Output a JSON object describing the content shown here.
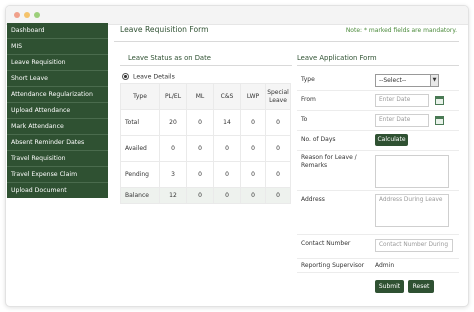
{
  "sidebar": {
    "items": [
      {
        "label": "Dashboard"
      },
      {
        "label": "MIS"
      },
      {
        "label": "Leave Requisition"
      },
      {
        "label": "Short Leave"
      },
      {
        "label": "Attendance Regularization"
      },
      {
        "label": "Upload Attendance"
      },
      {
        "label": "Mark Attendance"
      },
      {
        "label": "Absent Reminder Dates"
      },
      {
        "label": "Travel Requisition"
      },
      {
        "label": "Travel Expense Claim"
      },
      {
        "label": "Upload Document"
      }
    ]
  },
  "header": {
    "title": "Leave Requisition Form",
    "note": "Note: * marked fields are mandatory."
  },
  "status": {
    "title": "Leave Status as on Date",
    "radio_label": "Leave Details",
    "columns": [
      "Type",
      "PL/EL",
      "ML",
      "C&S",
      "LWP",
      "Special Leave"
    ],
    "rows": [
      {
        "label": "Total",
        "values": [
          "20",
          "0",
          "14",
          "0",
          "0"
        ]
      },
      {
        "label": "Availed",
        "values": [
          "0",
          "0",
          "0",
          "0",
          "0"
        ]
      },
      {
        "label": "Pending",
        "values": [
          "3",
          "0",
          "0",
          "0",
          "0"
        ]
      },
      {
        "label": "Balance",
        "values": [
          "12",
          "0",
          "0",
          "0",
          "0"
        ]
      }
    ]
  },
  "form": {
    "title": "Leave Application Form",
    "type_label": "Type",
    "type_value": "--Select--",
    "from_label": "From",
    "from_placeholder": "Enter Date",
    "to_label": "To",
    "to_placeholder": "Enter Date",
    "days_label": "No. of Days",
    "calculate_label": "Calculate",
    "reason_label": "Reason for Leave / Remarks",
    "address_label": "Address",
    "address_placeholder": "Address During Leave",
    "contact_label": "Contact Number",
    "contact_placeholder": "Contact Number During",
    "supervisor_label": "Reporting Supervisor",
    "supervisor_value": "Admin",
    "submit_label": "Submit",
    "reset_label": "Reset"
  },
  "colors": {
    "sidebar_bg": "#2f5132",
    "accent": "#2f5132",
    "note": "#4a8a3a"
  }
}
